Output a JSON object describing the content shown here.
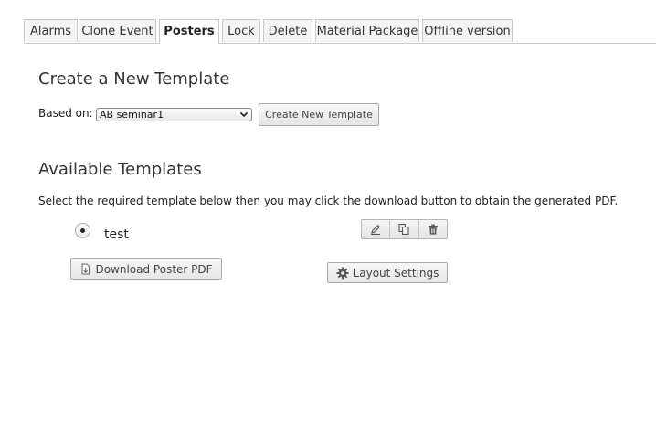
{
  "tabs": [
    {
      "label": "Alarms",
      "active": false
    },
    {
      "label": "Clone Event",
      "active": false
    },
    {
      "label": "Posters",
      "active": true
    },
    {
      "label": "Lock",
      "active": false
    },
    {
      "label": "Delete",
      "active": false
    },
    {
      "label": "Material Package",
      "active": false
    },
    {
      "label": "Offline version",
      "active": false
    }
  ],
  "create": {
    "heading": "Create a New Template",
    "based_on_label": "Based on:",
    "selected_option": "AB seminar1",
    "button_label": "Create New Template"
  },
  "available": {
    "heading": "Available Templates",
    "description": "Select the required template below then you may click the download button to obtain the generated PDF.",
    "templates": [
      {
        "name": "test",
        "selected": true,
        "download_label": "Download Poster PDF",
        "layout_label": "Layout Settings",
        "actions": [
          "edit-icon",
          "clone-icon",
          "trash-icon"
        ]
      }
    ]
  }
}
